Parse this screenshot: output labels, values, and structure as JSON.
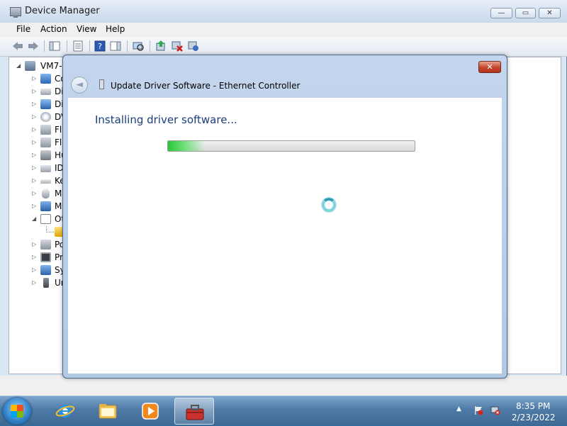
{
  "device_manager": {
    "title": "Device Manager",
    "menu": [
      "File",
      "Action",
      "View",
      "Help"
    ],
    "tree": {
      "root_label": "VM7-",
      "categories": [
        "Co",
        "Di",
        "Di",
        "DV",
        "Fl",
        "Fl",
        "Hu",
        "ID",
        "Ke",
        "M",
        "M",
        "Ot",
        "",
        "Po",
        "Pr",
        "Sy",
        "Ur"
      ]
    }
  },
  "dialog": {
    "title": "Update Driver Software - Ethernet Controller",
    "close_glyph": "✕",
    "back_glyph": "◄",
    "heading": "Installing driver software...",
    "progress": 0.15,
    "colors": {
      "heading": "#1a3e7e",
      "progress": "#2bc63b"
    }
  },
  "taskbar": {
    "clock_time": "8:35 PM",
    "clock_date": "2/23/2022",
    "pinned": [
      "internet-explorer",
      "windows-explorer",
      "media-player",
      "device-manager"
    ]
  },
  "icons": {
    "caption_minimize": "—",
    "caption_maximize": "▭",
    "caption_close": "✕",
    "tree_expand": "▷",
    "tree_collapse": "◢"
  }
}
